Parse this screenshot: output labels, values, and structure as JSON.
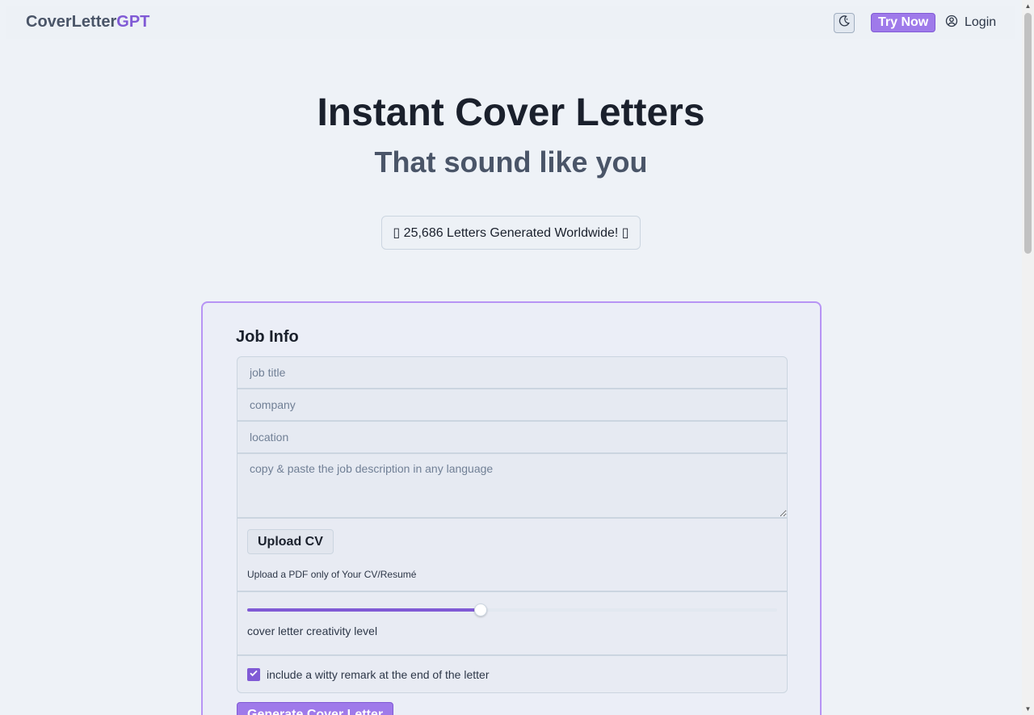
{
  "header": {
    "logo_part1": "CoverLetter",
    "logo_part2": "GPT",
    "theme_toggle_icon": "moon-icon",
    "try_now_label": "Try Now",
    "login_icon": "user-circle-icon",
    "login_label": "Login"
  },
  "hero": {
    "title": "Instant Cover Letters",
    "subtitle": "That sound like you",
    "counter_text": "▯ 25,686 Letters Generated Worldwide! ▯"
  },
  "form": {
    "section_title": "Job Info",
    "job_title_placeholder": "job title",
    "company_placeholder": "company",
    "location_placeholder": "location",
    "description_placeholder": "copy & paste the job description in any language",
    "upload_label": "Upload CV",
    "upload_hint": "Upload a PDF only of Your CV/Resumé",
    "creativity_label": "cover letter creativity level",
    "creativity_level": 0.44,
    "witty_label": "include a witty remark at the end of the letter",
    "witty_checked": true,
    "generate_label": "Generate Cover Letter"
  },
  "colors": {
    "accent": "#805ad5",
    "accent_light": "#9f7aea",
    "card_border": "#b794f4",
    "background": "#eef2f7"
  }
}
